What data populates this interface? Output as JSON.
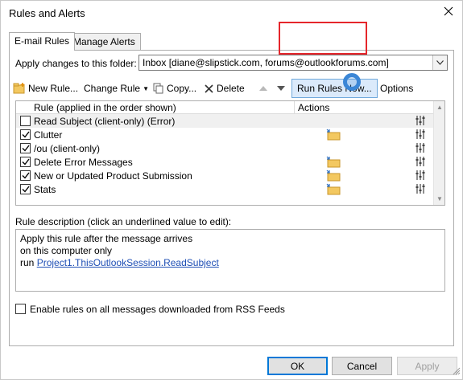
{
  "window": {
    "title": "Rules and Alerts",
    "close_glyph": "✕"
  },
  "tabs": [
    {
      "label": "E-mail Rules",
      "active": true
    },
    {
      "label": "Manage Alerts",
      "active": false
    }
  ],
  "folder": {
    "label": "Apply changes to this folder:",
    "value": "Inbox [diane@slipstick.com, forums@outlookforums.com]"
  },
  "toolbar": {
    "new_rule": "New Rule...",
    "change_rule": "Change Rule",
    "copy": "Copy...",
    "delete": "Delete",
    "run_rules_now": "Run Rules Now...",
    "options": "Options"
  },
  "rules_table": {
    "headers": {
      "rule": "Rule (applied in the order shown)",
      "actions": "Actions"
    },
    "rows": [
      {
        "label": "Read Subject  (client-only)  (Error)",
        "checked": false,
        "selected": true,
        "has_action": false
      },
      {
        "label": "Clutter",
        "checked": true,
        "selected": false,
        "has_action": true
      },
      {
        "label": "/ou  (client-only)",
        "checked": true,
        "selected": false,
        "has_action": true
      },
      {
        "label": "Delete Error Messages",
        "checked": true,
        "selected": false,
        "has_action": true
      },
      {
        "label": "New or Updated Product Submission",
        "checked": true,
        "selected": false,
        "has_action": true
      },
      {
        "label": "Stats",
        "checked": true,
        "selected": false,
        "has_action": true
      }
    ]
  },
  "description": {
    "label": "Rule description (click an underlined value to edit):",
    "line1": "Apply this rule after the message arrives",
    "line2": "on this computer only",
    "line3_prefix": "run ",
    "line3_link": "Project1.ThisOutlookSession.ReadSubject"
  },
  "rss": {
    "label": "Enable rules on all messages downloaded from RSS Feeds",
    "checked": false
  },
  "buttons": {
    "ok": "OK",
    "cancel": "Cancel",
    "apply": "Apply"
  },
  "colors": {
    "highlight": "#e5262b",
    "link": "#1f4fb5",
    "accent": "#0078d7"
  }
}
